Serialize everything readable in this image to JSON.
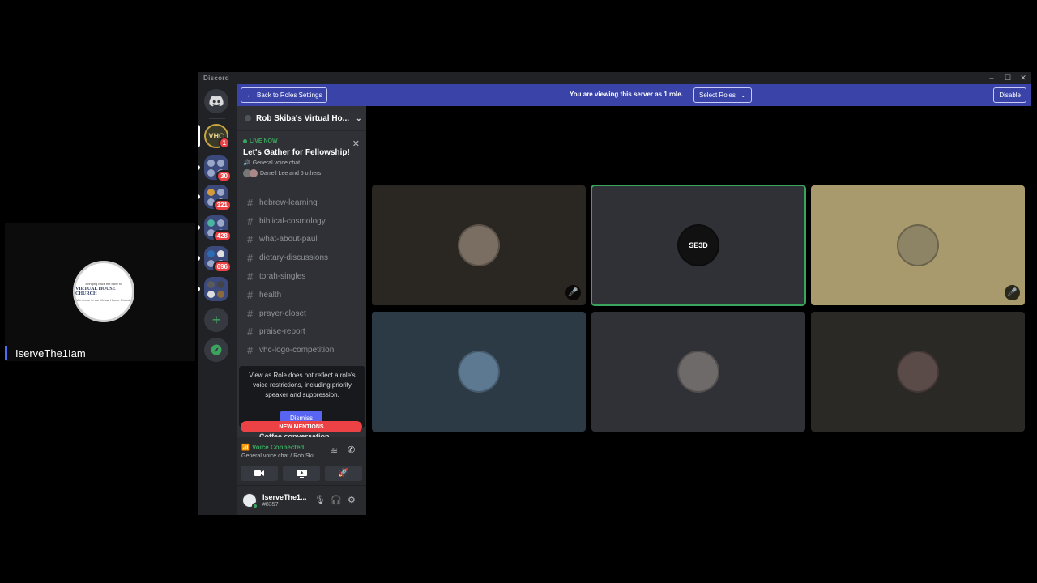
{
  "stream_tile": {
    "avatar_lines": [
      "Bringing back the bible to",
      "VIRTUAL HOUSE CHURCH",
      "We come to our Virtual House Church"
    ],
    "name": "IserveThe1Iam"
  },
  "app": {
    "title": "Discord",
    "window_controls": {
      "minimize": "–",
      "maximize": "☐",
      "close": "✕"
    }
  },
  "rail": {
    "home_icon": "discord-logo-icon",
    "servers": [
      {
        "name": "rob-skiba-server",
        "badge": "1",
        "selected": true
      },
      {
        "name": "folder-1",
        "badge": "30"
      },
      {
        "name": "folder-2",
        "badge": "321"
      },
      {
        "name": "folder-3",
        "badge": "428"
      },
      {
        "name": "folder-4",
        "badge": "696"
      },
      {
        "name": "folder-5",
        "badge": ""
      }
    ],
    "add_server": "+",
    "explore": "compass-icon"
  },
  "role_banner": {
    "back_label": "Back to Roles Settings",
    "message": "You are viewing this server as 1 role.",
    "select_label": "Select Roles",
    "disable_label": "Disable"
  },
  "sidebar": {
    "server_name": "Rob Skiba's Virtual Ho...",
    "live": {
      "badge": "LIVE NOW",
      "title": "Let's Gather for Fellowship!",
      "channel": "General voice chat",
      "people": "Darrell Lee and 5 others"
    },
    "channels": [
      "hebrew-learning",
      "biblical-cosmology",
      "what-about-paul",
      "dietary-discussions",
      "torah-singles",
      "health",
      "prayer-closet",
      "praise-report",
      "vhc-logo-competition"
    ],
    "tooltip": {
      "text": "View as Role does not reflect a role's voice restrictions, including priority speaker and suppression.",
      "dismiss": "Dismiss"
    },
    "new_mentions": "NEW MENTIONS",
    "partial_channel": "Coffee conversation"
  },
  "voice": {
    "status": "Voice Connected",
    "detail": "General voice chat / Rob Ski..."
  },
  "user": {
    "name": "IserveThe1...",
    "tag": "#8357"
  },
  "tiles": [
    {
      "name": "participant-1",
      "bg": "#2a2621",
      "avatar_color": "#7a6e62",
      "muted": true,
      "speaking": false
    },
    {
      "name": "participant-seed",
      "bg": "#2f3136",
      "avatar_text": "SE3D",
      "muted": false,
      "speaking": true
    },
    {
      "name": "participant-3",
      "bg": "#a99a6d",
      "avatar_color": "#8d8466",
      "muted": true,
      "speaking": false
    },
    {
      "name": "participant-4",
      "bg": "#2c3a45",
      "avatar_color": "#5d7891",
      "muted": false,
      "speaking": false
    },
    {
      "name": "participant-5",
      "bg": "#2f3136",
      "avatar_color": "#6f6a6a",
      "muted": false,
      "speaking": false
    },
    {
      "name": "participant-6",
      "bg": "#2b2925",
      "avatar_color": "#5a4a48",
      "muted": false,
      "speaking": false
    }
  ]
}
